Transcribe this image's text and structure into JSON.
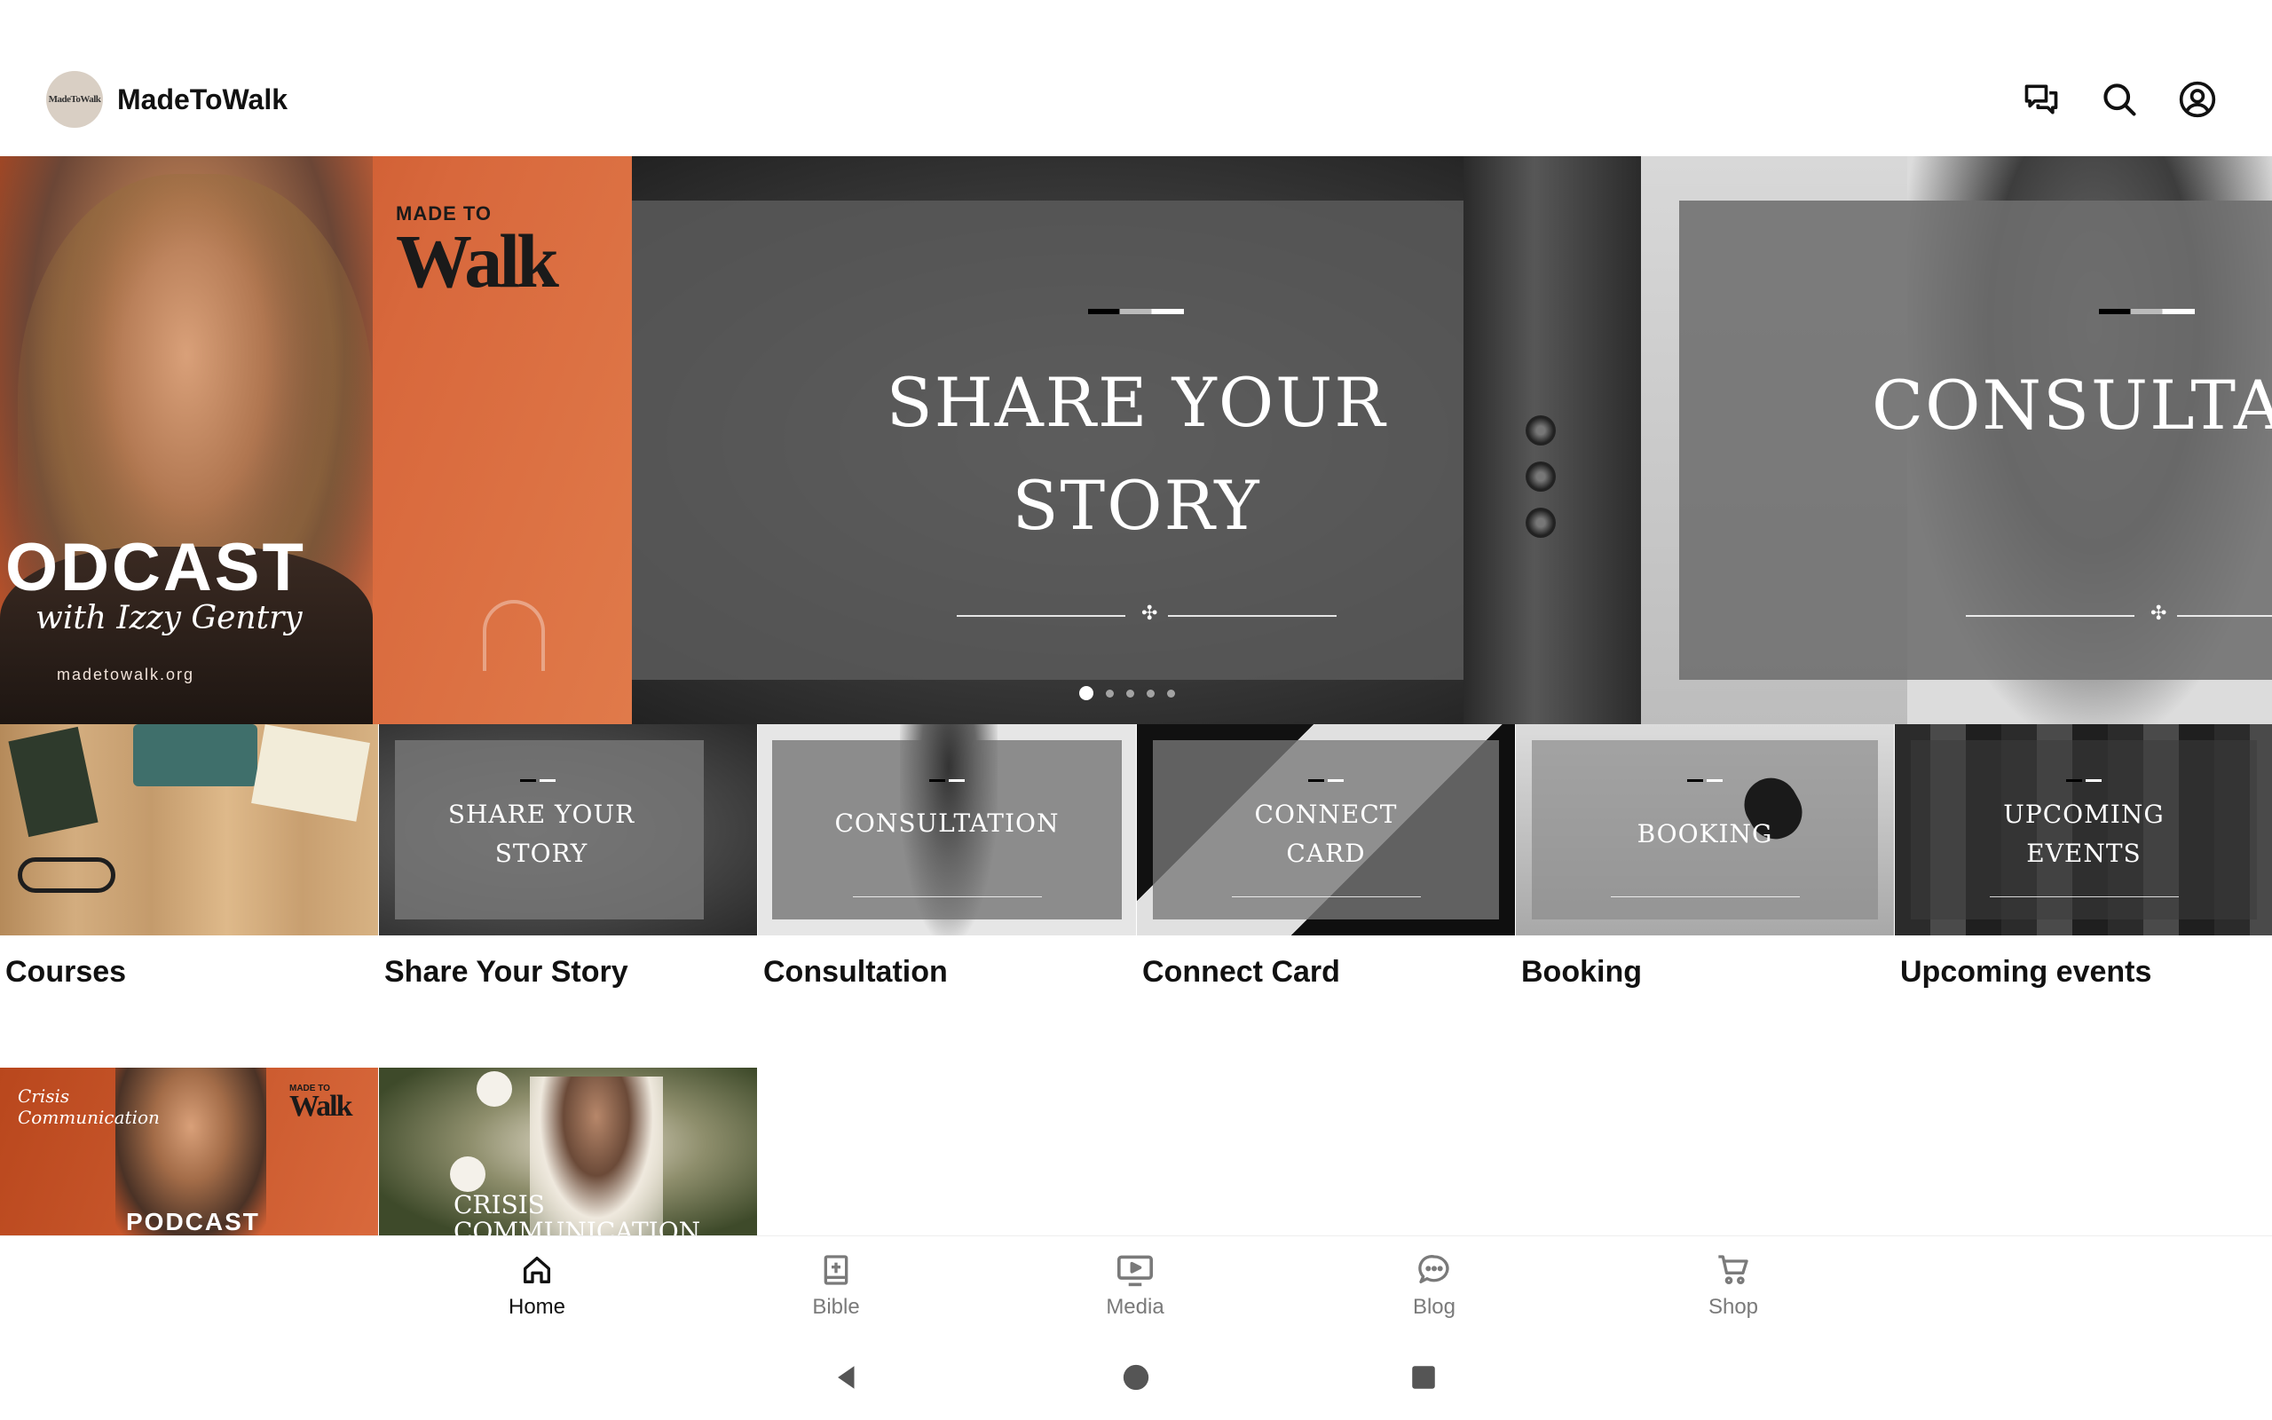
{
  "app": {
    "title": "MadeToWalk",
    "logo_text": "MadeToWalk"
  },
  "top_actions": {
    "chat_icon": "chat-bubbles-icon",
    "search_icon": "search-icon",
    "account_icon": "account-circle-icon"
  },
  "hero": {
    "podcast": {
      "brand_top": "MADE TO",
      "brand_bottom": "Walk",
      "word": "ODCAST",
      "signature": "with Izzy Gentry",
      "url": "madetowalk.org"
    },
    "share": {
      "line1": "SHARE YOUR",
      "line2": "STORY"
    },
    "consult": {
      "title": "CONSULTAT"
    },
    "slides_count": 5,
    "active_index": 0
  },
  "tiles": [
    {
      "label": "Courses",
      "overlay": []
    },
    {
      "label": "Share Your Story",
      "overlay": [
        "SHARE YOUR",
        "STORY"
      ]
    },
    {
      "label": "Consultation",
      "overlay": [
        "CONSULTATION"
      ]
    },
    {
      "label": "Connect Card",
      "overlay": [
        "CONNECT",
        "CARD"
      ]
    },
    {
      "label": "Booking",
      "overlay": [
        "BOOKING"
      ]
    },
    {
      "label": "Upcoming events",
      "overlay": [
        "UPCOMING",
        "EVENTS"
      ]
    }
  ],
  "row2": {
    "podcast": {
      "script": "Crisis Communication",
      "brand_top": "MADE TO",
      "brand_bottom": "Walk",
      "word": "PODCAST"
    },
    "crisis": {
      "line1": "CRISIS",
      "line2": "COMMUNICATION"
    }
  },
  "bottom_nav": [
    {
      "label": "Home",
      "icon": "home-icon",
      "active": true
    },
    {
      "label": "Bible",
      "icon": "bible-icon",
      "active": false
    },
    {
      "label": "Media",
      "icon": "media-play-icon",
      "active": false
    },
    {
      "label": "Blog",
      "icon": "blog-chat-icon",
      "active": false
    },
    {
      "label": "Shop",
      "icon": "cart-icon",
      "active": false
    }
  ],
  "colors": {
    "podcast_orange": "#d8683c",
    "nav_active": "#111111",
    "nav_inactive": "#7a7a7a"
  }
}
